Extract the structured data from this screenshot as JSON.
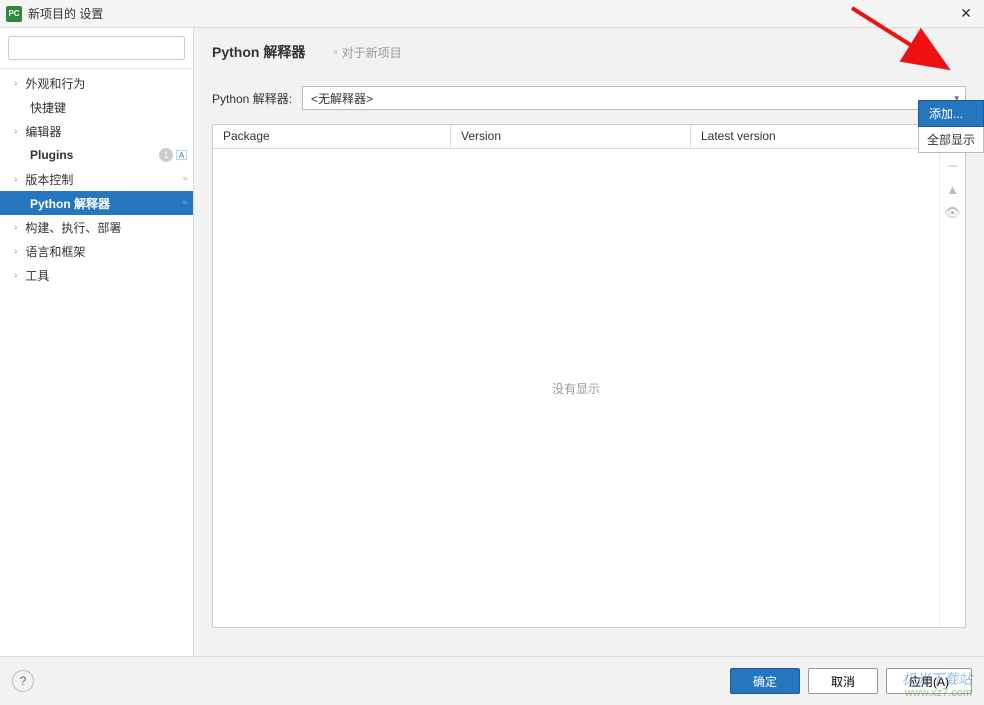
{
  "window": {
    "title": "新项目的 设置",
    "app_icon_text": "PC"
  },
  "sidebar": {
    "search_placeholder": "",
    "items": [
      {
        "label": "外观和行为",
        "expandable": true
      },
      {
        "label": "快捷键",
        "child": true
      },
      {
        "label": "编辑器",
        "expandable": true
      },
      {
        "label": "Plugins",
        "child": true,
        "bold": true,
        "badge": "1"
      },
      {
        "label": "版本控制",
        "expandable": true
      },
      {
        "label": "Python 解释器",
        "child": true,
        "selected": true
      },
      {
        "label": "构建、执行、部署",
        "expandable": true
      },
      {
        "label": "语言和框架",
        "expandable": true
      },
      {
        "label": "工具",
        "expandable": true
      }
    ]
  },
  "content": {
    "header_title": "Python 解释器",
    "sub_tab": "对于新项目",
    "interpreter_label": "Python 解释器:",
    "interpreter_value": "<无解释器>",
    "add_button": "添加...",
    "show_all_button": "全部显示",
    "table": {
      "col_package": "Package",
      "col_version": "Version",
      "col_latest": "Latest version",
      "empty_text": "没有显示"
    }
  },
  "footer": {
    "ok": "确定",
    "cancel": "取消",
    "apply": "应用(A)"
  },
  "watermark": {
    "name": "极光下载站",
    "site": "www.xz7.com"
  }
}
